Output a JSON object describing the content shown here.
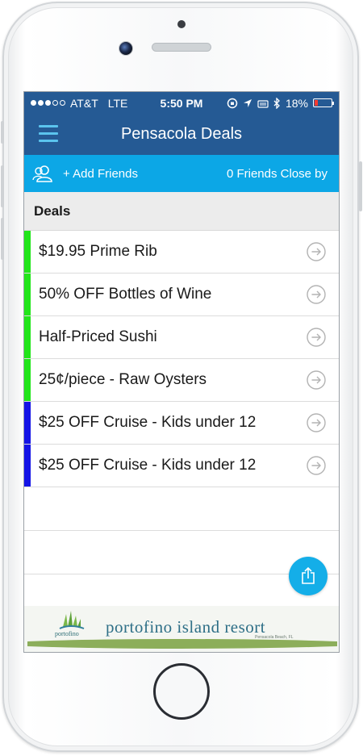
{
  "status_bar": {
    "carrier": "AT&T",
    "network": "LTE",
    "time": "5:50 PM",
    "battery_percent": "18%",
    "battery_level": 0.18,
    "signal_bars_filled": 3,
    "signal_bars_total": 5
  },
  "nav": {
    "title": "Pensacola Deals",
    "menu_icon": "hamburger-menu-icon"
  },
  "friends_bar": {
    "add_label": "+ Add Friends",
    "close_label": "0 Friends Close by",
    "icon": "friends-icon"
  },
  "section": {
    "title": "Deals"
  },
  "deals": [
    {
      "label": "$19.95 Prime Rib",
      "color": "#22e51a"
    },
    {
      "label": "50% OFF Bottles of Wine",
      "color": "#22e51a"
    },
    {
      "label": "Half-Priced Sushi",
      "color": "#22e51a"
    },
    {
      "label": "25¢/piece - Raw Oysters",
      "color": "#22e51a"
    },
    {
      "label": "$25 OFF Cruise - Kids under 12",
      "color": "#1414e6"
    },
    {
      "label": "$25 OFF Cruise - Kids under 12",
      "color": "#1414e6"
    }
  ],
  "share_button": {
    "icon": "share-icon"
  },
  "ad": {
    "title": "portofino island resort",
    "logo_text": "portofino",
    "subtitle": "Pensacola Beach, FL"
  },
  "colors": {
    "nav_bg": "#255a94",
    "friends_bg": "#0ca7e6",
    "accent": "#14aee8"
  }
}
